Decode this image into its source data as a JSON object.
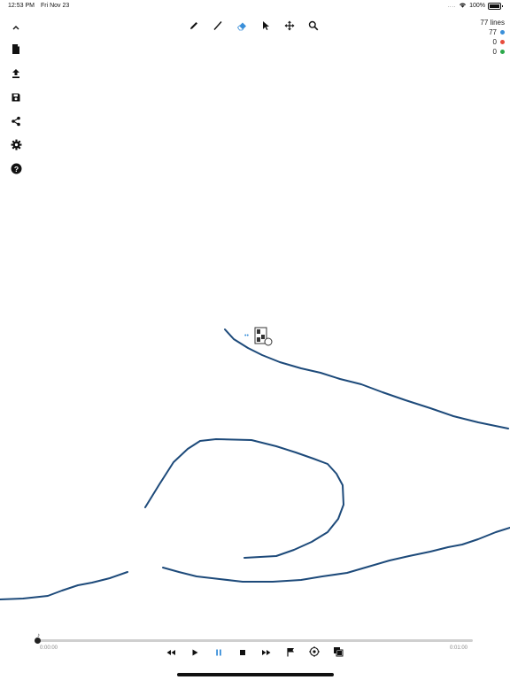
{
  "status_bar": {
    "time": "12:53 PM",
    "date": "Fri Nov 23",
    "signal_dots": "....",
    "battery": "100%"
  },
  "sidebar": {
    "items": [
      {
        "name": "collapse",
        "icon": "chevron-up-icon"
      },
      {
        "name": "new-document",
        "icon": "document-icon"
      },
      {
        "name": "upload",
        "icon": "upload-icon"
      },
      {
        "name": "save",
        "icon": "save-icon"
      },
      {
        "name": "share",
        "icon": "share-icon"
      },
      {
        "name": "settings",
        "icon": "gear-icon"
      },
      {
        "name": "help",
        "icon": "help-icon"
      }
    ]
  },
  "toolbar": {
    "tools": [
      {
        "name": "pencil",
        "icon": "pencil-icon"
      },
      {
        "name": "line",
        "icon": "line-icon"
      },
      {
        "name": "eraser",
        "icon": "eraser-icon",
        "active": true
      },
      {
        "name": "select",
        "icon": "pointer-icon"
      },
      {
        "name": "move",
        "icon": "move-icon"
      },
      {
        "name": "zoom",
        "icon": "magnifier-icon"
      }
    ],
    "active_color": "#3a8fd9"
  },
  "stats": {
    "total": "77 lines",
    "rows": [
      {
        "count": "77",
        "color": "#3a8fd9"
      },
      {
        "count": "0",
        "color": "#e74c3c"
      },
      {
        "count": "0",
        "color": "#2aa84a"
      }
    ]
  },
  "drawing": {
    "stroke_color": "#1d4a7a"
  },
  "timeline": {
    "start": "0:00:00",
    "end": "0:01:00",
    "progress": 0
  },
  "playback": {
    "buttons": [
      {
        "name": "rewind",
        "icon": "rewind-icon"
      },
      {
        "name": "play",
        "icon": "play-icon"
      },
      {
        "name": "pause",
        "icon": "pause-icon",
        "active": true
      },
      {
        "name": "stop",
        "icon": "stop-icon"
      },
      {
        "name": "fast-forward",
        "icon": "fast-forward-icon"
      },
      {
        "name": "flag",
        "icon": "flag-icon"
      },
      {
        "name": "target",
        "icon": "target-icon"
      },
      {
        "name": "layers",
        "icon": "layers-icon"
      }
    ]
  }
}
